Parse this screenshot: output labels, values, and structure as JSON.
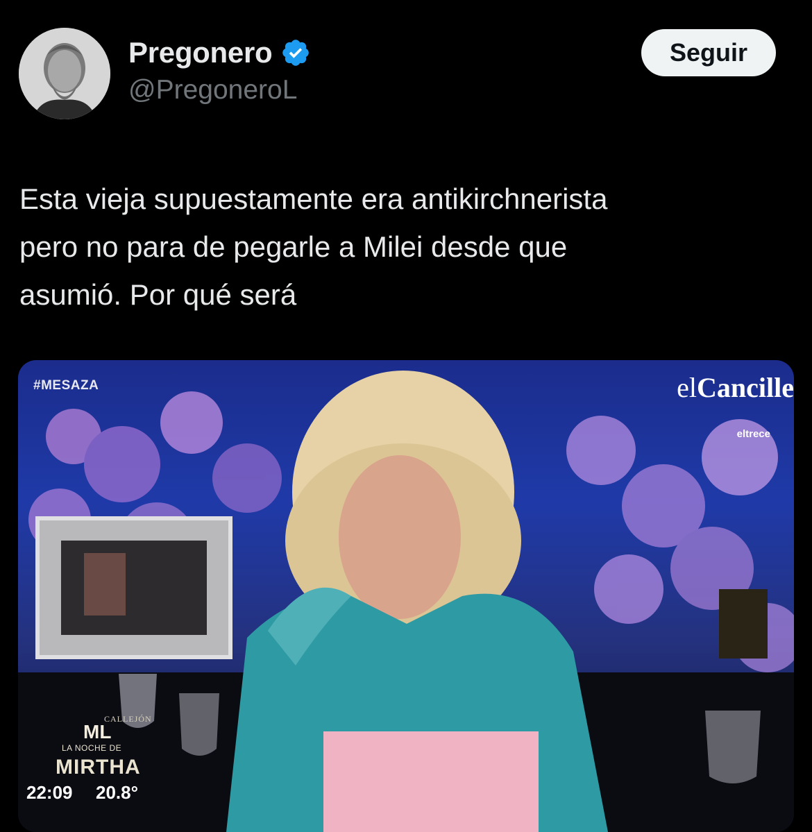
{
  "author": {
    "display_name": "Pregonero",
    "handle": "@PregoneroL",
    "avatar_icon": "portrait-avatar",
    "verified_icon": "verified-badge-icon",
    "verified_color": "#1d9bf0"
  },
  "follow_button": {
    "label": "Seguir"
  },
  "tweet": {
    "lines": [
      "Esta vieja supuestamente era antikirchnerista",
      "pero no para de pegarle a Milei desde que",
      "asumió. Por qué será"
    ]
  },
  "media": {
    "hashtag": "#MESAZA",
    "channel_logo_prefix": "el",
    "channel_logo_main": "Cancille",
    "channel_sub": "eltrece",
    "placard_text": "CALLEJÓN",
    "show_abbrev": "ML",
    "show_subtitle": "LA NOCHE DE",
    "show_title": "MIRTHA",
    "clock": "22:09",
    "temperature": "20.8°"
  },
  "colors": {
    "background": "#000000",
    "text_primary": "#e7e9ea",
    "text_secondary": "#71767b",
    "button_bg": "#eff3f4",
    "button_text": "#0f1419"
  }
}
